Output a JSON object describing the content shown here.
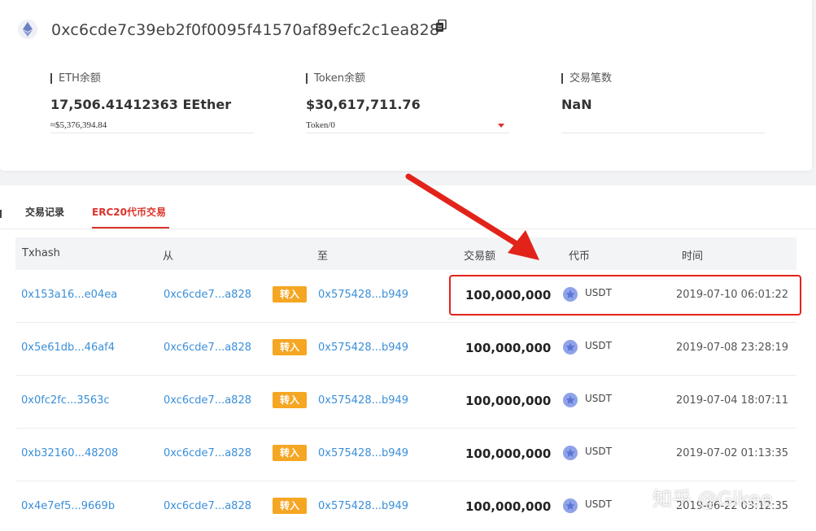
{
  "header": {
    "address": "0xc6cde7c39eb2f0f0095f41570af89efc2c1ea828",
    "logo_icon": "ethereum-icon",
    "copy_icon": "copy-icon"
  },
  "stats": {
    "eth": {
      "label": "ETH余额",
      "value": "17,506.41412363 EEther",
      "sub": "≈$5,376,394.84"
    },
    "token": {
      "label": "Token余额",
      "value": "$30,617,711.76",
      "sub": "Token/0"
    },
    "tx": {
      "label": "交易笔数",
      "value": "NaN"
    }
  },
  "tabs": [
    {
      "label": "交易记录"
    },
    {
      "label": "ERC20代币交易"
    }
  ],
  "table": {
    "headers": [
      "Txhash",
      "从",
      "至",
      "交易额",
      "代币",
      "时间"
    ],
    "direction_label": "转入",
    "rows": [
      {
        "txhash": "0x153a16...e04ea",
        "from": "0xc6cde7...a828",
        "to": "0x575428...b949",
        "amount": "100,000,000",
        "token": "USDT",
        "time": "2019-07-10 06:01:22"
      },
      {
        "txhash": "0x5e61db...46af4",
        "from": "0xc6cde7...a828",
        "to": "0x575428...b949",
        "amount": "100,000,000",
        "token": "USDT",
        "time": "2019-07-08 23:28:19"
      },
      {
        "txhash": "0x0fc2fc...3563c",
        "from": "0xc6cde7...a828",
        "to": "0x575428...b949",
        "amount": "100,000,000",
        "token": "USDT",
        "time": "2019-07-04 18:07:11"
      },
      {
        "txhash": "0xb32160...48208",
        "from": "0xc6cde7...a828",
        "to": "0x575428...b949",
        "amount": "100,000,000",
        "token": "USDT",
        "time": "2019-07-02 01:13:35"
      },
      {
        "txhash": "0x4e7ef5...9669b",
        "from": "0xc6cde7...a828",
        "to": "0x575428...b949",
        "amount": "100,000,000",
        "token": "USDT",
        "time": "2019-06-22 03:12:35"
      }
    ]
  },
  "watermark": "知乎 @Gikee",
  "colors": {
    "accent": "#d8332b",
    "link": "#3b8fd8",
    "badge": "#f5a623",
    "annotation": "#e2231a"
  }
}
